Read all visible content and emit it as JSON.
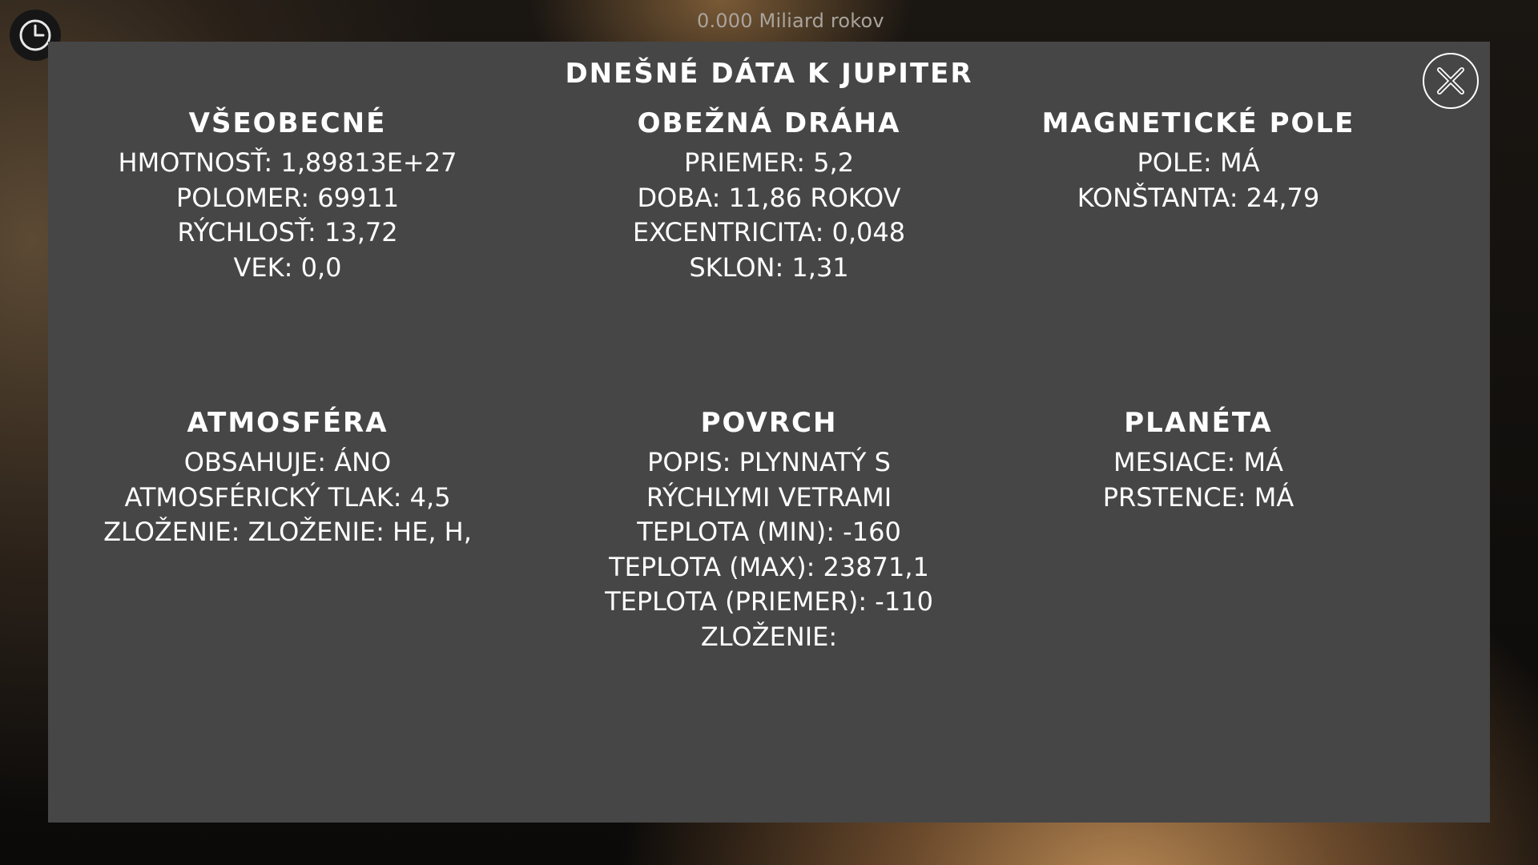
{
  "background": {
    "timeline_label": "0.000 Miliard rokov"
  },
  "panel": {
    "title": "DNEŠNÉ DÁTA K JUPITER",
    "sections": [
      {
        "title": "VŠEOBECNÉ",
        "lines": [
          "HMOTNOSŤ: 1,89813E+27",
          "POLOMER: 69911",
          "RÝCHLOSŤ: 13,72",
          "VEK: 0,0"
        ]
      },
      {
        "title": "OBEŽNÁ DRÁHA",
        "lines": [
          "PRIEMER: 5,2",
          "DOBA: 11,86 ROKOV",
          "EXCENTRICITA: 0,048",
          "SKLON: 1,31"
        ]
      },
      {
        "title": "MAGNETICKÉ POLE",
        "lines": [
          "POLE: MÁ",
          "KONŠTANTA: 24,79"
        ]
      },
      {
        "title": "ATMOSFÉRA",
        "lines": [
          "OBSAHUJE: ÁNO",
          "ATMOSFÉRICKÝ TLAK: 4,5",
          "ZLOŽENIE: ZLOŽENIE: HE, H,"
        ]
      },
      {
        "title": "POVRCH",
        "lines": [
          "POPIS: PLYNNATÝ S",
          "RÝCHLYMI VETRAMI",
          "TEPLOTA (MIN): -160",
          "TEPLOTA (MAX): 23871,1",
          "TEPLOTA (PRIEMER): -110",
          "ZLOŽENIE:"
        ]
      },
      {
        "title": "PLANÉTA",
        "lines": [
          "MESIACE: MÁ",
          "PRSTENCE: MÁ"
        ]
      }
    ]
  },
  "icons": {
    "clock": "clock-icon",
    "close": "close-icon"
  },
  "colors": {
    "panel_bg": "#464646",
    "text": "#ffffff"
  }
}
